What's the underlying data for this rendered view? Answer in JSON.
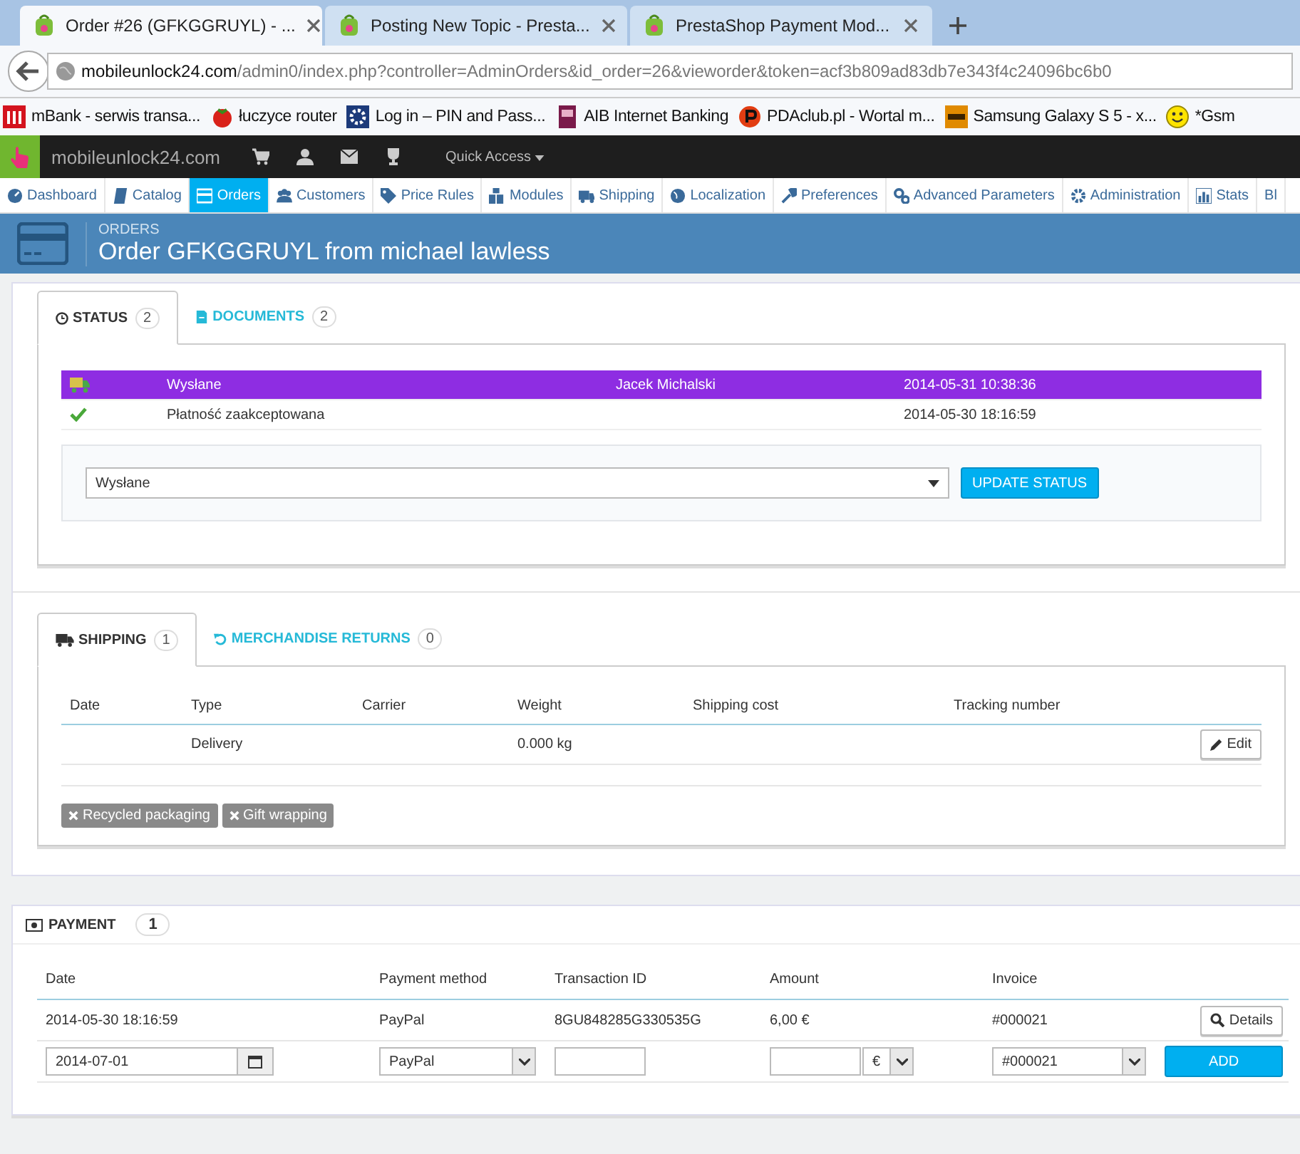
{
  "browser": {
    "tabs": [
      {
        "title": "Order #26 (GFKGGRUYL) - ...",
        "selected": true
      },
      {
        "title": "Posting New Topic - Presta...",
        "selected": false
      },
      {
        "title": "PrestaShop Payment Mod...",
        "selected": false
      }
    ],
    "address": {
      "domain": "mobileunlock24.com",
      "path": "/admin0/index.php?controller=AdminOrders&id_order=26&vieworder&token=acf3b809ad83db7e343f4c24096bc6b0"
    },
    "bookmarks": [
      {
        "kind": "bank",
        "label": "mBank - serwis transa..."
      },
      {
        "kind": "tomato",
        "label": "łuczyce router"
      },
      {
        "kind": "gear",
        "label": "Log in – PIN and Pass..."
      },
      {
        "kind": "aib",
        "label": "AIB Internet Banking"
      },
      {
        "kind": "p",
        "label": "PDAclub.pl - Wortal m..."
      },
      {
        "kind": "xda",
        "label": "Samsung Galaxy S 5 - x..."
      },
      {
        "kind": "smiley",
        "label": "*Gsm"
      }
    ]
  },
  "admin_bar": {
    "shop": "mobileunlock24.com",
    "quick_access": "Quick Access"
  },
  "menu": [
    {
      "kind": "dashboard",
      "label": "Dashboard",
      "selected": false
    },
    {
      "kind": "catalog",
      "label": "Catalog",
      "selected": false
    },
    {
      "kind": "orders",
      "label": "Orders",
      "selected": true
    },
    {
      "kind": "customers",
      "label": "Customers",
      "selected": false
    },
    {
      "kind": "price",
      "label": "Price Rules",
      "selected": false
    },
    {
      "kind": "modules",
      "label": "Modules",
      "selected": false
    },
    {
      "kind": "shipping",
      "label": "Shipping",
      "selected": false
    },
    {
      "kind": "localization",
      "label": "Localization",
      "selected": false
    },
    {
      "kind": "preferences",
      "label": "Preferences",
      "selected": false
    },
    {
      "kind": "advanced",
      "label": "Advanced Parameters",
      "selected": false
    },
    {
      "kind": "administration",
      "label": "Administration",
      "selected": false
    },
    {
      "kind": "stats",
      "label": "Stats",
      "selected": false
    },
    {
      "kind": "cut",
      "label": "Bl",
      "selected": false
    }
  ],
  "header": {
    "breadcrumb": "ORDERS",
    "title": "Order GFKGGRUYL from michael lawless"
  },
  "status_panel": {
    "tabs": [
      {
        "kind": "clock",
        "label": "STATUS",
        "count": "2",
        "selected": true
      },
      {
        "kind": "file",
        "label": "DOCUMENTS",
        "count": "2",
        "selected": false
      }
    ],
    "history": [
      {
        "kind": "shipped",
        "status": "Wysłane",
        "employee": "Jacek Michalski",
        "date": "2014-05-31 10:38:36",
        "color": "#8e2de2"
      },
      {
        "kind": "accepted",
        "status": "Płatność zaakceptowana",
        "date": "2014-05-30 18:16:59"
      }
    ],
    "select": "Wysłane",
    "button": "UPDATE STATUS"
  },
  "shipping_panel": {
    "tabs": [
      {
        "kind": "truck",
        "label": "SHIPPING",
        "count": "1",
        "selected": true
      },
      {
        "kind": "undo",
        "label": "MERCHANDISE RETURNS",
        "count": "0",
        "selected": false
      }
    ],
    "columns": [
      "Date",
      "Type",
      "Carrier",
      "Weight",
      "Shipping cost",
      "Tracking number"
    ],
    "rows": [
      {
        "type": "Delivery",
        "weight": "0.000 kg",
        "action": "Edit"
      }
    ],
    "tags": [
      "Recycled packaging",
      "Gift wrapping"
    ]
  },
  "payment_panel": {
    "title": "PAYMENT",
    "count": "1",
    "columns": [
      "Date",
      "Payment method",
      "Transaction ID",
      "Amount",
      "Invoice"
    ],
    "rows": [
      {
        "date": "2014-05-30 18:16:59",
        "method": "PayPal",
        "transaction": "8GU848285G330535G",
        "amount": "6,00 €",
        "invoice": "#000021",
        "action": "Details"
      }
    ],
    "form": {
      "date": "2014-07-01",
      "method": "PayPal",
      "currency": "€",
      "invoice": "#000021",
      "button": "ADD"
    }
  }
}
